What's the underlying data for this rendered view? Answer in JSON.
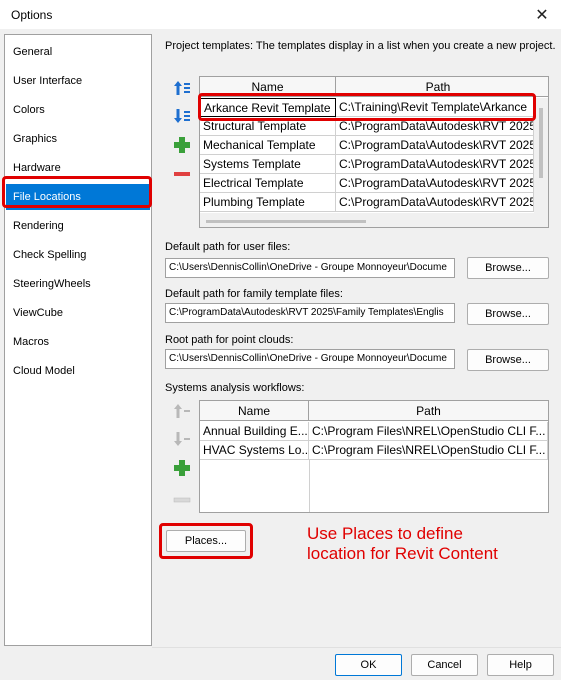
{
  "window": {
    "title": "Options"
  },
  "sidebar": {
    "items": [
      {
        "label": "General"
      },
      {
        "label": "User Interface"
      },
      {
        "label": "Colors"
      },
      {
        "label": "Graphics"
      },
      {
        "label": "Hardware"
      },
      {
        "label": "File Locations",
        "selected": true
      },
      {
        "label": "Rendering"
      },
      {
        "label": "Check Spelling"
      },
      {
        "label": "SteeringWheels"
      },
      {
        "label": "ViewCube"
      },
      {
        "label": "Macros"
      },
      {
        "label": "Cloud Model"
      }
    ]
  },
  "project_templates": {
    "label": "Project templates:  The templates display in a list when you create a new project.",
    "columns": [
      "Name",
      "Path"
    ],
    "rows": [
      {
        "name": "Arkance Revit Template",
        "path": "C:\\Training\\Revit Template\\Arkance"
      },
      {
        "name": "Structural Template",
        "path": "C:\\ProgramData\\Autodesk\\RVT 2025"
      },
      {
        "name": "Mechanical Template",
        "path": "C:\\ProgramData\\Autodesk\\RVT 2025"
      },
      {
        "name": "Systems Template",
        "path": "C:\\ProgramData\\Autodesk\\RVT 2025"
      },
      {
        "name": "Electrical Template",
        "path": "C:\\ProgramData\\Autodesk\\RVT 2025"
      },
      {
        "name": "Plumbing Template",
        "path": "C:\\ProgramData\\Autodesk\\RVT 2025"
      }
    ]
  },
  "user_files": {
    "label": "Default path for user files:",
    "value": "C:\\Users\\DennisCollin\\OneDrive - Groupe Monnoyeur\\Docume",
    "browse": "Browse..."
  },
  "family_templates": {
    "label": "Default path for family template files:",
    "value": "C:\\ProgramData\\Autodesk\\RVT 2025\\Family Templates\\Englis",
    "browse": "Browse..."
  },
  "point_clouds": {
    "label": "Root path for point clouds:",
    "value": "C:\\Users\\DennisCollin\\OneDrive - Groupe Monnoyeur\\Docume",
    "browse": "Browse..."
  },
  "analysis_workflows": {
    "label": "Systems analysis workflows:",
    "columns": [
      "Name",
      "Path"
    ],
    "rows": [
      {
        "name": "Annual Building E...",
        "path": "C:\\Program Files\\NREL\\OpenStudio CLI F..."
      },
      {
        "name": "HVAC Systems Lo...",
        "path": "C:\\Program Files\\NREL\\OpenStudio CLI F..."
      }
    ]
  },
  "places_button": "Places...",
  "annotation": "Use Places to define location for Revit Content",
  "footer": {
    "ok": "OK",
    "cancel": "Cancel",
    "help": "Help"
  },
  "colors": {
    "selection": "#0078d7",
    "annotation": "#e00000",
    "icon_blue": "#1e6fd0",
    "icon_green": "#3aa03a",
    "icon_red": "#e04040",
    "icon_disabled": "#b8b8b8"
  }
}
